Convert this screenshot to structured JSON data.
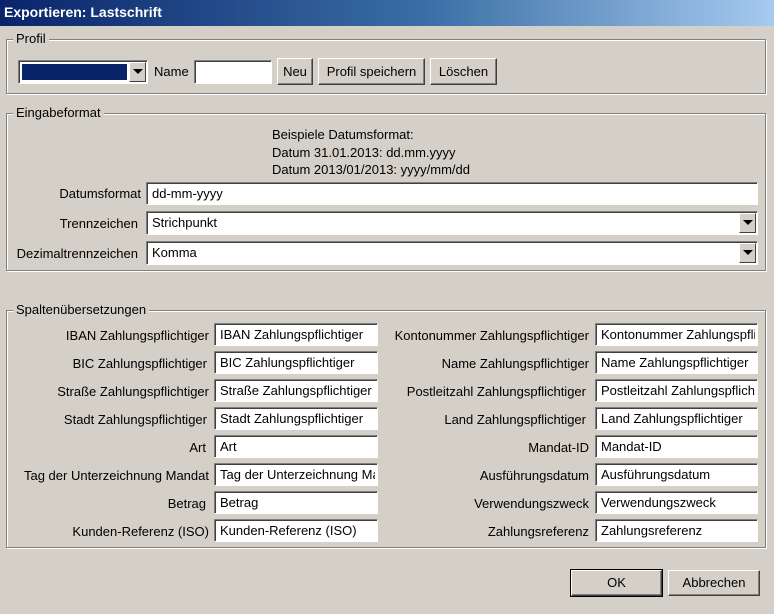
{
  "window": {
    "title": "Exportieren: Lastschrift"
  },
  "profil": {
    "legend": "Profil",
    "profile_select_value": "",
    "name_label": "Name",
    "name_value": "",
    "new_button": "Neu",
    "save_button": "Profil speichern",
    "delete_button": "Löschen"
  },
  "eingabeformat": {
    "legend": "Eingabeformat",
    "examples_title": "Beispiele Datumsformat:",
    "example1": "Datum 31.01.2013: dd.mm.yyyy",
    "example2": "Datum 2013/01/2013: yyyy/mm/dd",
    "date_format_label": "Datumsformat",
    "date_format_value": "dd-mm-yyyy",
    "separator_label": "Trennzeichen",
    "separator_value": "Strichpunkt",
    "decimal_label": "Dezimaltrennzeichen",
    "decimal_value": "Komma"
  },
  "spalten": {
    "legend": "Spaltenübersetzungen",
    "left": [
      {
        "label": "IBAN Zahlungspflichtiger",
        "value": "IBAN Zahlungspflichtiger"
      },
      {
        "label": "BIC Zahlungspflichtiger",
        "value": "BIC Zahlungspflichtiger"
      },
      {
        "label": "Straße Zahlungspflichtiger",
        "value": "Straße Zahlungspflichtiger"
      },
      {
        "label": "Stadt Zahlungspflichtiger",
        "value": "Stadt Zahlungspflichtiger"
      },
      {
        "label": "Art",
        "value": "Art"
      },
      {
        "label": "Tag der Unterzeichnung Mandat",
        "value": "Tag der Unterzeichnung Mandat"
      },
      {
        "label": "Betrag",
        "value": "Betrag"
      },
      {
        "label": "Kunden-Referenz (ISO)",
        "value": "Kunden-Referenz (ISO)"
      }
    ],
    "right": [
      {
        "label": "Kontonummer Zahlungspflichtiger",
        "value": "Kontonummer Zahlungspflichtiger"
      },
      {
        "label": "Name Zahlungspflichtiger",
        "value": "Name Zahlungspflichtiger"
      },
      {
        "label": "Postleitzahl Zahlungspflichtiger",
        "value": "Postleitzahl Zahlungspflichtiger"
      },
      {
        "label": "Land Zahlungspflichtiger",
        "value": "Land Zahlungspflichtiger"
      },
      {
        "label": "Mandat-ID",
        "value": "Mandat-ID"
      },
      {
        "label": "Ausführungsdatum",
        "value": "Ausführungsdatum"
      },
      {
        "label": "Verwendungszweck",
        "value": "Verwendungszweck"
      },
      {
        "label": "Zahlungsreferenz",
        "value": "Zahlungsreferenz"
      }
    ]
  },
  "footer": {
    "ok_button": "OK",
    "cancel_button": "Abbrechen"
  },
  "colors": {
    "title_gradient_start": "#0a246a",
    "selection": "#0a246a",
    "face": "#d4d0c8"
  }
}
